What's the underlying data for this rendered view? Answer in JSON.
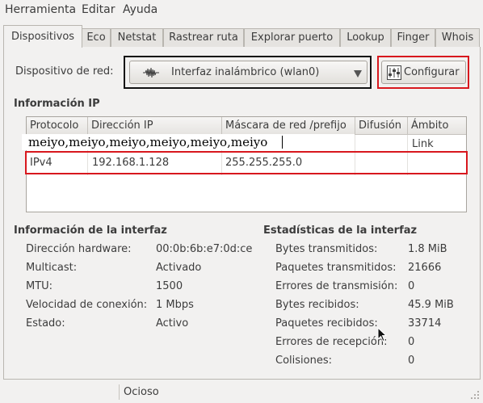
{
  "menubar": {
    "items": [
      "Herramienta",
      "Editar",
      "Ayuda"
    ]
  },
  "tabs": [
    "Dispositivos",
    "Eco",
    "Netstat",
    "Rastrear ruta",
    "Explorar puerto",
    "Lookup",
    "Finger",
    "Whois"
  ],
  "active_tab": "Dispositivos",
  "device": {
    "label": "Dispositivo de red:",
    "selected": "Interfaz inalámbrico (wlan0)",
    "configure_label": "Configurar"
  },
  "ip_info": {
    "title": "Información IP",
    "columns": [
      "Protocolo",
      "Dirección IP",
      "Máscara de red /prefijo",
      "Difusión",
      "Ámbito"
    ],
    "editor_text": "meiyo,meiyo,meiyo,meiyo,meiyo,meiyo",
    "row1_scope": "Link",
    "row2": [
      "IPv4",
      "192.168.1.128",
      "255.255.255.0",
      "",
      ""
    ]
  },
  "interface_info": {
    "title": "Información de la interfaz",
    "rows": [
      {
        "label": "Dirección hardware:",
        "value": "00:0b:6b:e7:0d:ce"
      },
      {
        "label": "Multicast:",
        "value": "Activado"
      },
      {
        "label": "MTU:",
        "value": "1500"
      },
      {
        "label": "Velocidad de conexión:",
        "value": "1 Mbps"
      },
      {
        "label": "Estado:",
        "value": "Activo"
      }
    ]
  },
  "interface_stats": {
    "title": "Estadísticas de la interfaz",
    "rows": [
      {
        "label": "Bytes transmitidos:",
        "value": "1.8 MiB"
      },
      {
        "label": "Paquetes transmitidos:",
        "value": "21666"
      },
      {
        "label": "Errores de transmisión:",
        "value": "0"
      },
      {
        "label": "Bytes recibidos:",
        "value": "45.9 MiB"
      },
      {
        "label": "Paquetes recibidos:",
        "value": "33714"
      },
      {
        "label": "Errores de recepción:",
        "value": "0"
      },
      {
        "label": "Colisiones:",
        "value": "0"
      }
    ]
  },
  "status": {
    "text": "Ocioso"
  },
  "icons": {
    "combo_icon": "waveform-icon",
    "dropdown": "triangle-down-icon",
    "configure_icon": "equalizer-icon",
    "pointer": "mouse-pointer-icon",
    "grip": "resize-grip-icon"
  }
}
